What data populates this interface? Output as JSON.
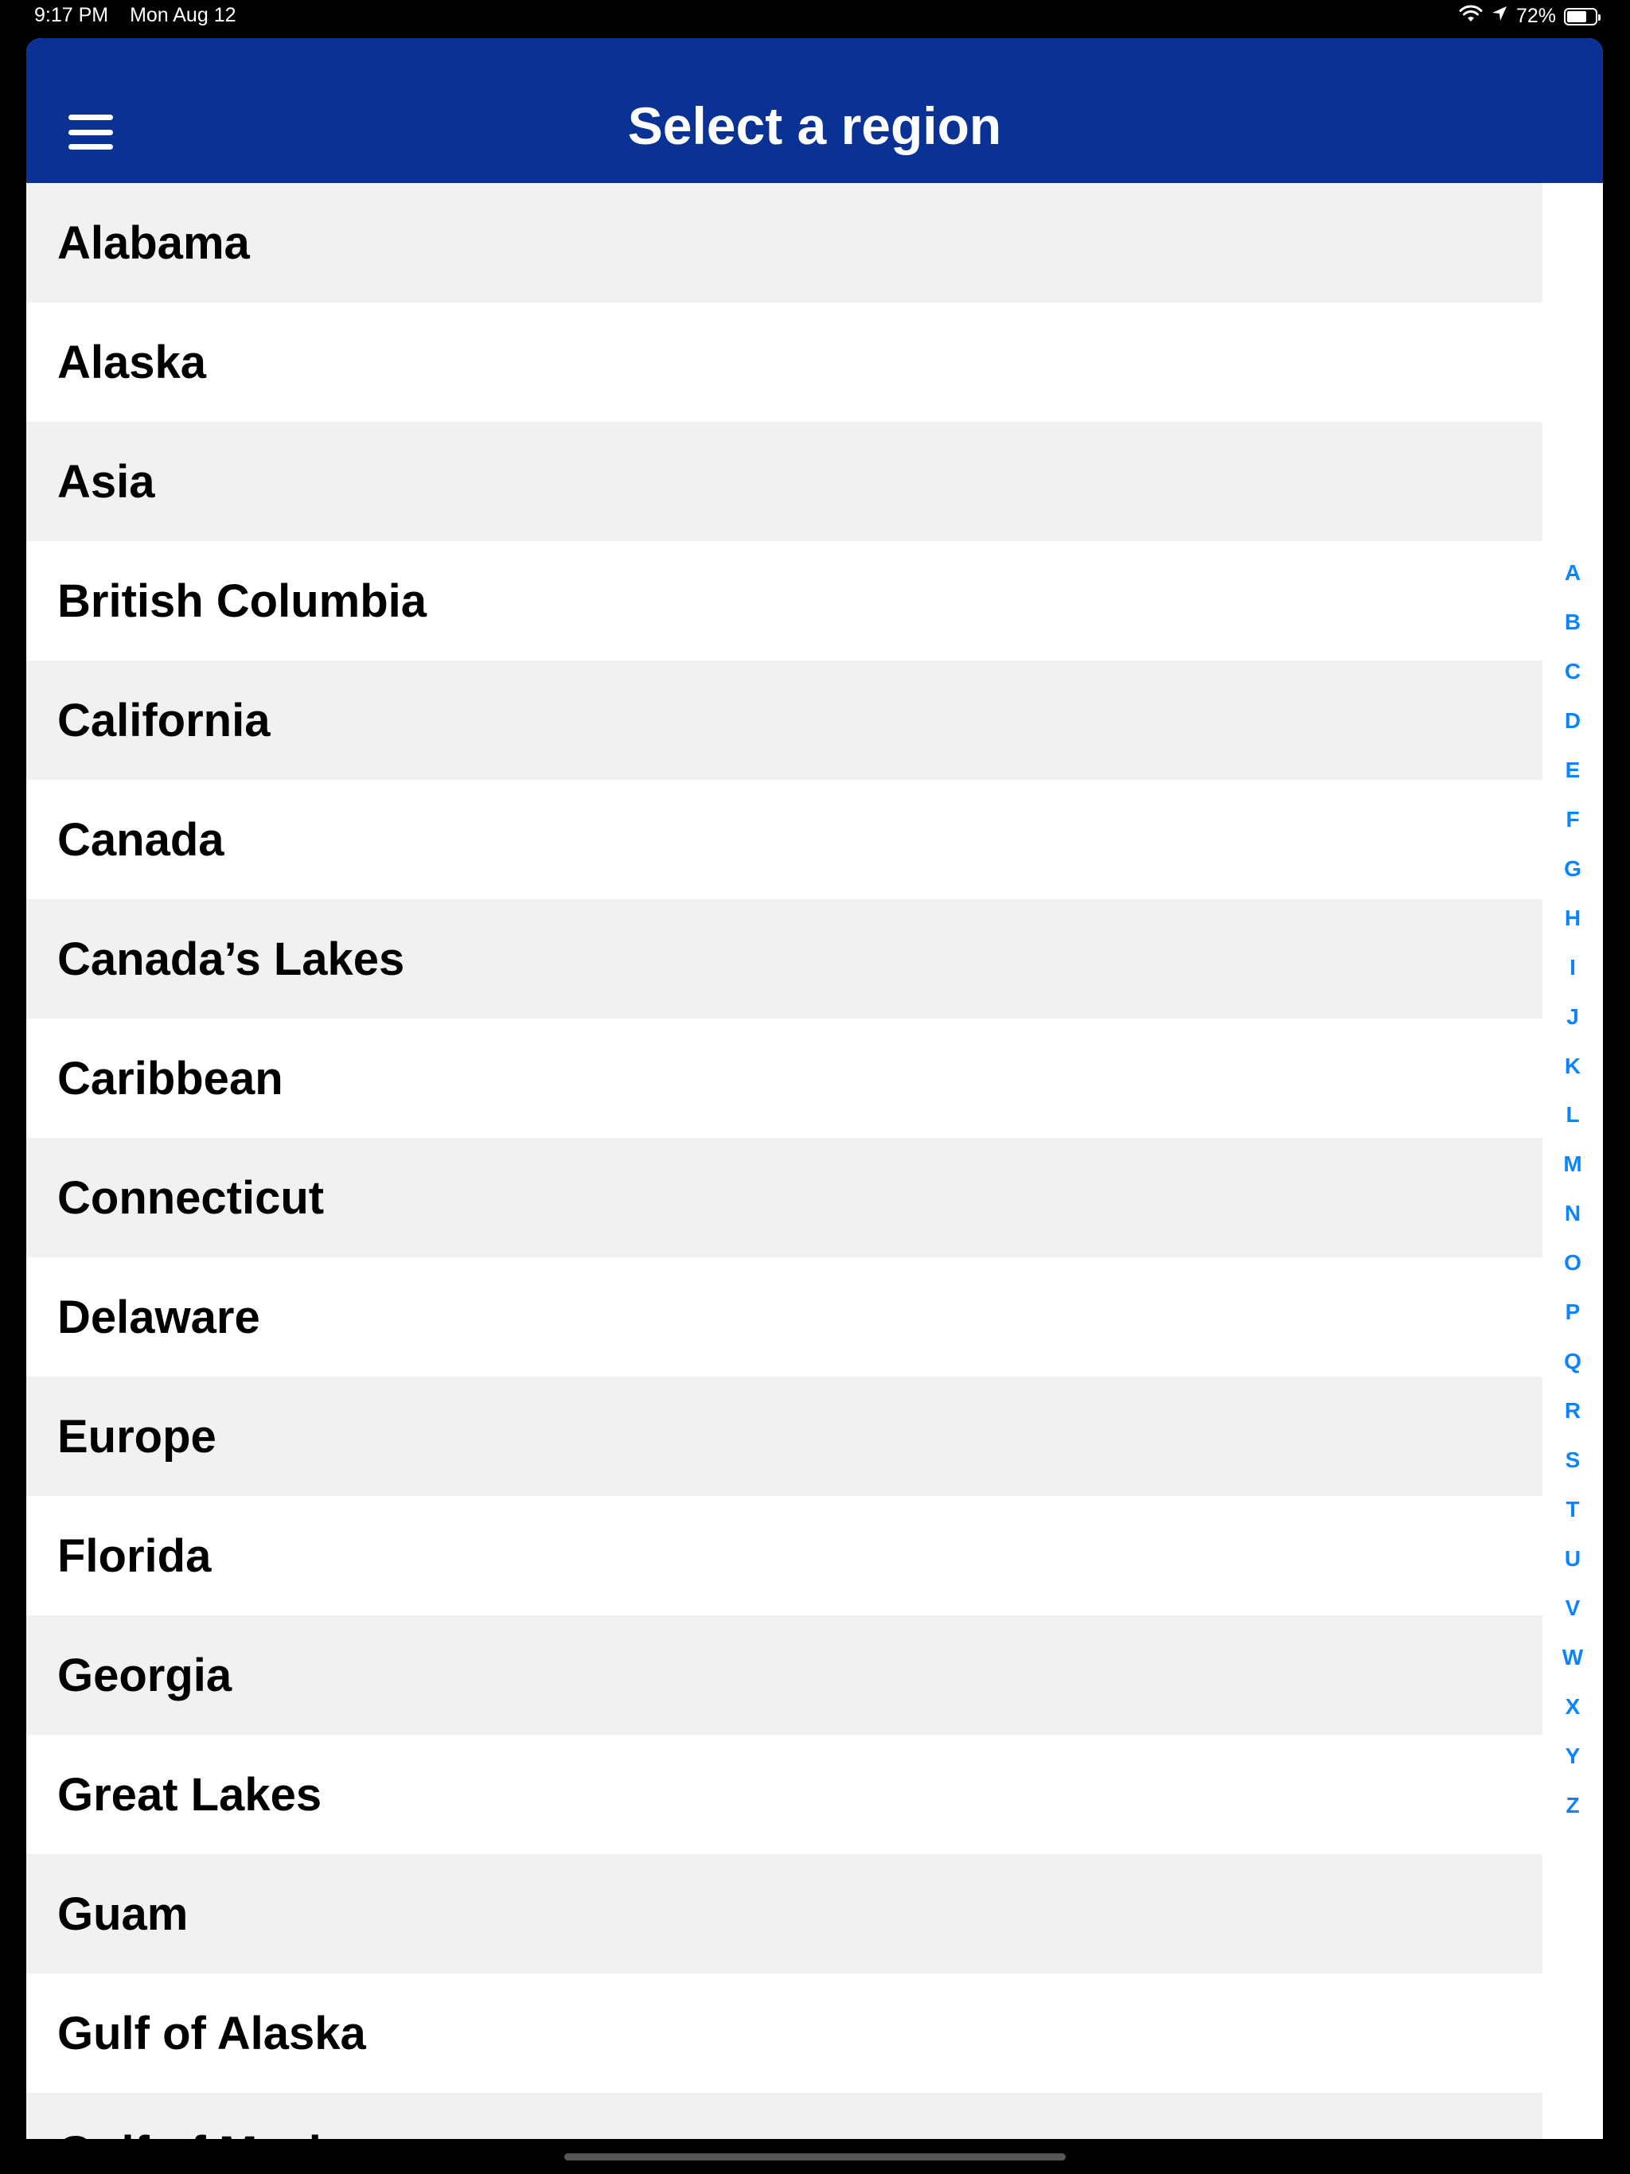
{
  "status_bar": {
    "time": "9:17 PM",
    "date": "Mon Aug 12",
    "battery_percent_text": "72%",
    "battery_level": 0.72,
    "icons": [
      "wifi-icon",
      "location-arrow-icon",
      "battery-icon"
    ]
  },
  "nav": {
    "title": "Select a region",
    "menu_icon": "hamburger-menu-icon"
  },
  "regions": [
    "Alabama",
    "Alaska",
    "Asia",
    "British Columbia",
    "California",
    "Canada",
    "Canada’s Lakes",
    "Caribbean",
    "Connecticut",
    "Delaware",
    "Europe",
    "Florida",
    "Georgia",
    "Great Lakes",
    "Guam",
    "Gulf of Alaska",
    "Gulf of Mexico"
  ],
  "index_letters": [
    "A",
    "B",
    "C",
    "D",
    "E",
    "F",
    "G",
    "H",
    "I",
    "J",
    "K",
    "L",
    "M",
    "N",
    "O",
    "P",
    "Q",
    "R",
    "S",
    "T",
    "U",
    "V",
    "W",
    "X",
    "Y",
    "Z"
  ],
  "colors": {
    "nav_background": "#0a3294",
    "index_accent": "#0a84ff",
    "row_alt_background": "#f1f1f1"
  }
}
